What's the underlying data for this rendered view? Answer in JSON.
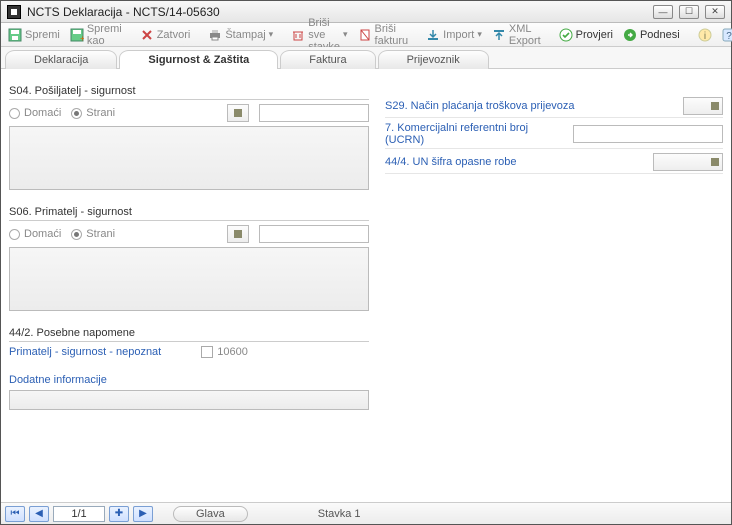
{
  "window": {
    "title": "NCTS Deklaracija - NCTS/14-05630"
  },
  "toolbar": {
    "spremi": "Spremi",
    "spremi_kao": "Spremi kao",
    "zatvori": "Zatvori",
    "stampaj": "Štampaj",
    "brisi_sve_stavke": "Briši sve stavke",
    "brisi_fakturu": "Briši fakturu",
    "import": "Import",
    "xml_export": "XML Export",
    "provjeri": "Provjeri",
    "podnesi": "Podnesi"
  },
  "tabs": {
    "deklaracija": "Deklaracija",
    "sigurnost_zastita": "Sigurnost & Zaštita",
    "faktura": "Faktura",
    "prijevoznik": "Prijevoznik"
  },
  "left": {
    "s04_title": "S04. Pošiljatelj - sigurnost",
    "domaci": "Domaći",
    "strani": "Strani",
    "s06_title": "S06. Primatelj - sigurnost",
    "posebne_napomene_title": "44/2. Posebne napomene",
    "primatelj_nepoznat": "Primatelj - sigurnost - nepoznat",
    "primatelj_nepoznat_code": "10600",
    "dodatne_informacije": "Dodatne informacije"
  },
  "right": {
    "nacin_placanja": "S29. Način plaćanja troškova prijevoza",
    "komercijalni_ref": "7. Komercijalni referentni broj (UCRN)",
    "un_sifra": "44/4. UN šifra opasne robe"
  },
  "status": {
    "counter": "1/1",
    "glava": "Glava",
    "stavka": "Stavka  1"
  }
}
